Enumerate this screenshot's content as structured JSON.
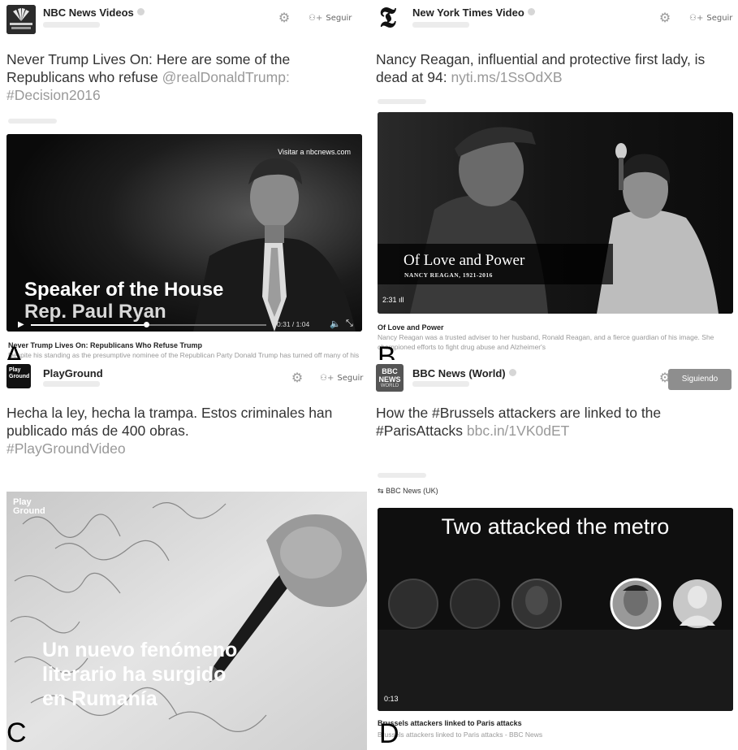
{
  "panels": {
    "a": {
      "letter": "A",
      "account": "NBC News Videos",
      "follow_label": "Seguir",
      "tweet": "Never Trump Lives On: Here are some of the Republicans who refuse ",
      "mention": "@realDonaldTrump:",
      "hashtag": "#Decision2016",
      "video": {
        "site_overlay": "Visitar a nbcnews.com",
        "caption_line1": "Speaker of the House",
        "caption_line2": "Rep. Paul Ryan",
        "time": "0:31 / 1:04"
      },
      "card_title": "Never Trump Lives On: Republicans Who Refuse Trump",
      "card_desc": "Despite his standing as the presumptive nominee of the Republican Party Donald Trump has turned off many of his colleagues in the GOP."
    },
    "b": {
      "letter": "B",
      "account": "New York Times Video",
      "follow_label": "Seguir",
      "tweet": "Nancy Reagan, influential and protective first lady, is dead at 94: ",
      "link": "nyti.ms/1SsOdXB",
      "video": {
        "title": "Of Love and Power",
        "subtitle": "NANCY REAGAN, 1921-2016",
        "time": "2:31"
      },
      "card_title": "Of Love and Power",
      "card_desc": "Nancy Reagan was a trusted adviser to her husband, Ronald Reagan, and a fierce guardian of his image. She championed efforts to fight drug abuse and Alzheimer's"
    },
    "c": {
      "letter": "C",
      "account": "PlayGround",
      "avatar_text": "Play Ground",
      "follow_label": "Seguir",
      "tweet": "Hecha la ley, hecha la trampa. Estos criminales han publicado más de 400 obras.",
      "hashtag": "#PlayGroundVideo",
      "video": {
        "logo": "Play Ground",
        "caption_line1": "Un nuevo fenómeno",
        "caption_line2": "literario ha surgido",
        "caption_line3": "en Rumanía"
      }
    },
    "d": {
      "letter": "D",
      "account": "BBC News (World)",
      "avatar_text": "BBC NEWS",
      "avatar_sub": "WORLD",
      "following_label": "Siguiendo",
      "tweet": "How the #Brussels attackers are linked to the #ParisAttacks ",
      "link": "bbc.in/1VK0dET",
      "retweeted_by": "BBC News (UK)",
      "video": {
        "headline": "Two attacked the metro",
        "time": "0:13"
      },
      "card_title": "Brussels attackers linked to Paris attacks",
      "card_desc": "Brussels attackers linked to Paris attacks - BBC News"
    }
  },
  "colors": {
    "link_gray": "#999999",
    "text": "#333333",
    "following_button": "#8e8e8e"
  },
  "icons": {
    "gear": "gear-icon",
    "follow": "person-add-icon",
    "play": "play-icon",
    "volume": "volume-icon",
    "fullscreen": "fullscreen-icon",
    "retweet": "retweet-icon"
  }
}
